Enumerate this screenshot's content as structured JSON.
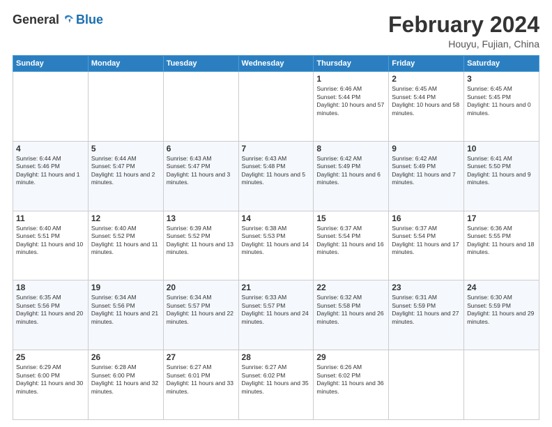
{
  "header": {
    "logo_general": "General",
    "logo_blue": "Blue",
    "month_year": "February 2024",
    "location": "Houyu, Fujian, China"
  },
  "days_of_week": [
    "Sunday",
    "Monday",
    "Tuesday",
    "Wednesday",
    "Thursday",
    "Friday",
    "Saturday"
  ],
  "weeks": [
    [
      {
        "day": "",
        "info": ""
      },
      {
        "day": "",
        "info": ""
      },
      {
        "day": "",
        "info": ""
      },
      {
        "day": "",
        "info": ""
      },
      {
        "day": "1",
        "info": "Sunrise: 6:46 AM\nSunset: 5:44 PM\nDaylight: 10 hours and 57 minutes."
      },
      {
        "day": "2",
        "info": "Sunrise: 6:45 AM\nSunset: 5:44 PM\nDaylight: 10 hours and 58 minutes."
      },
      {
        "day": "3",
        "info": "Sunrise: 6:45 AM\nSunset: 5:45 PM\nDaylight: 11 hours and 0 minutes."
      }
    ],
    [
      {
        "day": "4",
        "info": "Sunrise: 6:44 AM\nSunset: 5:46 PM\nDaylight: 11 hours and 1 minute."
      },
      {
        "day": "5",
        "info": "Sunrise: 6:44 AM\nSunset: 5:47 PM\nDaylight: 11 hours and 2 minutes."
      },
      {
        "day": "6",
        "info": "Sunrise: 6:43 AM\nSunset: 5:47 PM\nDaylight: 11 hours and 3 minutes."
      },
      {
        "day": "7",
        "info": "Sunrise: 6:43 AM\nSunset: 5:48 PM\nDaylight: 11 hours and 5 minutes."
      },
      {
        "day": "8",
        "info": "Sunrise: 6:42 AM\nSunset: 5:49 PM\nDaylight: 11 hours and 6 minutes."
      },
      {
        "day": "9",
        "info": "Sunrise: 6:42 AM\nSunset: 5:49 PM\nDaylight: 11 hours and 7 minutes."
      },
      {
        "day": "10",
        "info": "Sunrise: 6:41 AM\nSunset: 5:50 PM\nDaylight: 11 hours and 9 minutes."
      }
    ],
    [
      {
        "day": "11",
        "info": "Sunrise: 6:40 AM\nSunset: 5:51 PM\nDaylight: 11 hours and 10 minutes."
      },
      {
        "day": "12",
        "info": "Sunrise: 6:40 AM\nSunset: 5:52 PM\nDaylight: 11 hours and 11 minutes."
      },
      {
        "day": "13",
        "info": "Sunrise: 6:39 AM\nSunset: 5:52 PM\nDaylight: 11 hours and 13 minutes."
      },
      {
        "day": "14",
        "info": "Sunrise: 6:38 AM\nSunset: 5:53 PM\nDaylight: 11 hours and 14 minutes."
      },
      {
        "day": "15",
        "info": "Sunrise: 6:37 AM\nSunset: 5:54 PM\nDaylight: 11 hours and 16 minutes."
      },
      {
        "day": "16",
        "info": "Sunrise: 6:37 AM\nSunset: 5:54 PM\nDaylight: 11 hours and 17 minutes."
      },
      {
        "day": "17",
        "info": "Sunrise: 6:36 AM\nSunset: 5:55 PM\nDaylight: 11 hours and 18 minutes."
      }
    ],
    [
      {
        "day": "18",
        "info": "Sunrise: 6:35 AM\nSunset: 5:56 PM\nDaylight: 11 hours and 20 minutes."
      },
      {
        "day": "19",
        "info": "Sunrise: 6:34 AM\nSunset: 5:56 PM\nDaylight: 11 hours and 21 minutes."
      },
      {
        "day": "20",
        "info": "Sunrise: 6:34 AM\nSunset: 5:57 PM\nDaylight: 11 hours and 22 minutes."
      },
      {
        "day": "21",
        "info": "Sunrise: 6:33 AM\nSunset: 5:57 PM\nDaylight: 11 hours and 24 minutes."
      },
      {
        "day": "22",
        "info": "Sunrise: 6:32 AM\nSunset: 5:58 PM\nDaylight: 11 hours and 26 minutes."
      },
      {
        "day": "23",
        "info": "Sunrise: 6:31 AM\nSunset: 5:59 PM\nDaylight: 11 hours and 27 minutes."
      },
      {
        "day": "24",
        "info": "Sunrise: 6:30 AM\nSunset: 5:59 PM\nDaylight: 11 hours and 29 minutes."
      }
    ],
    [
      {
        "day": "25",
        "info": "Sunrise: 6:29 AM\nSunset: 6:00 PM\nDaylight: 11 hours and 30 minutes."
      },
      {
        "day": "26",
        "info": "Sunrise: 6:28 AM\nSunset: 6:00 PM\nDaylight: 11 hours and 32 minutes."
      },
      {
        "day": "27",
        "info": "Sunrise: 6:27 AM\nSunset: 6:01 PM\nDaylight: 11 hours and 33 minutes."
      },
      {
        "day": "28",
        "info": "Sunrise: 6:27 AM\nSunset: 6:02 PM\nDaylight: 11 hours and 35 minutes."
      },
      {
        "day": "29",
        "info": "Sunrise: 6:26 AM\nSunset: 6:02 PM\nDaylight: 11 hours and 36 minutes."
      },
      {
        "day": "",
        "info": ""
      },
      {
        "day": "",
        "info": ""
      }
    ]
  ]
}
